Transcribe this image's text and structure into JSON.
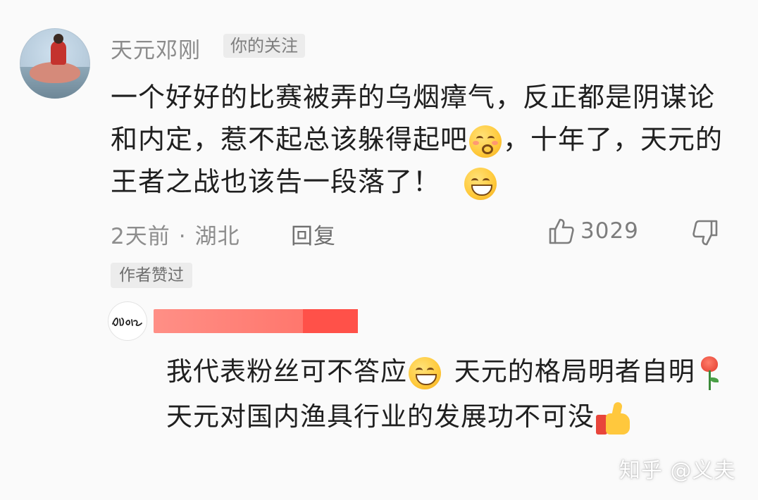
{
  "comment": {
    "username": "天元邓刚",
    "badge": "你的关注",
    "text_part1": "一个好好的比赛被弄的乌烟瘴气，反正都是阴谋论和内定，惹不起总该躲得起吧",
    "text_part2": "，十年了，天元的王者之战也该告一段落了！",
    "time": "2天前",
    "dot": "·",
    "location": "湖北",
    "reply_label": "回复",
    "like_count": "3029",
    "author_liked": "作者赞过"
  },
  "reply": {
    "text_part1": "我代表粉丝可不答应",
    "text_part2": " 天元的格局明者自明",
    "text_part3": " 天元对国内渔具行业的发展功不可没"
  },
  "watermark": "知乎 @义夫",
  "colors": {
    "background": "#fafafa",
    "meta_text": "#8d8d8d",
    "redaction": "#ff6e64",
    "emoji_yellow": "#ffc93a"
  }
}
